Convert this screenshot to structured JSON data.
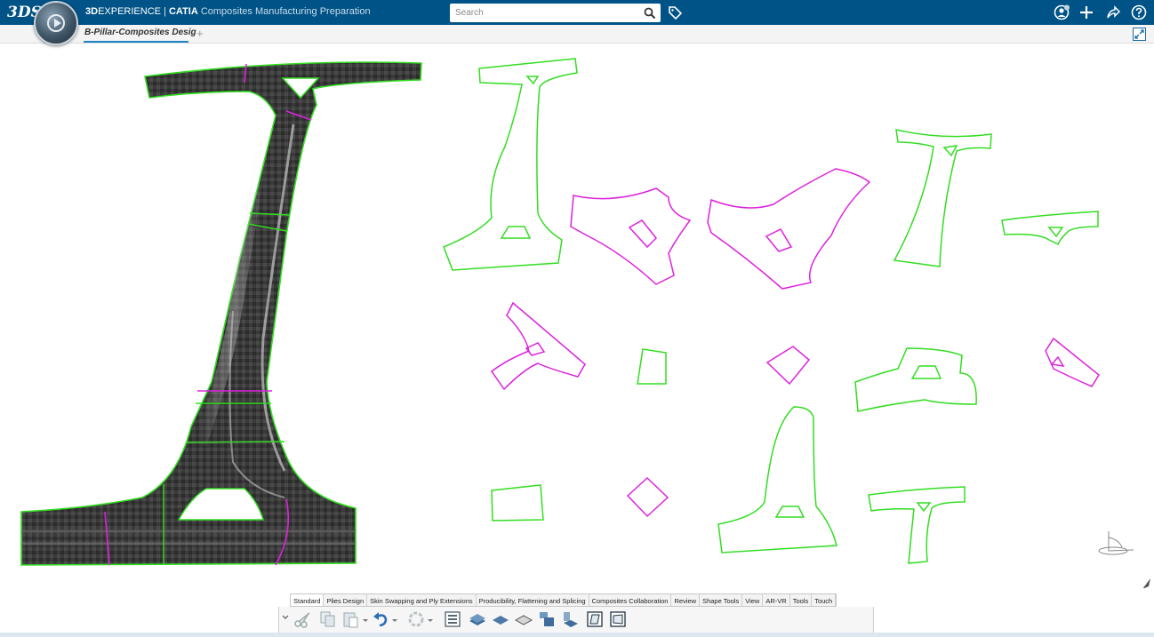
{
  "header": {
    "brand_logo": "3DS",
    "brand_3d": "3D",
    "brand_experience": "EXPERIENCE",
    "separator": " | ",
    "brand_catia": "CATIA",
    "app_name": " Composites Manufacturing Preparation",
    "search": {
      "placeholder": "Search",
      "value": ""
    },
    "icons": [
      "compass-icon",
      "search-icon",
      "tag-icon",
      "user-icon",
      "plus-icon",
      "share-icon",
      "help-icon"
    ],
    "accent_color": "#005386"
  },
  "tabs": {
    "active_label": "B-Pillar-Composites Desig",
    "add_label": "+"
  },
  "viewport": {
    "colors": {
      "ply_outline": "#33dd22",
      "splice_outline": "#dd22dd",
      "laminate": "#3b3b3b"
    }
  },
  "action_bar": {
    "tabs": [
      "Standard",
      "Plies Design",
      "Skin Swapping and Ply Extensions",
      "Producibility, Flattening and Splicing",
      "Composites Collaboration",
      "Review",
      "Shape Tools",
      "View",
      "AR-VR",
      "Tools",
      "Touch"
    ],
    "active_tab": "Standard",
    "tools": [
      "cut-icon",
      "copy-icon",
      "paste-icon",
      "undo-icon",
      "update-icon",
      "ply-table-icon",
      "plies-group-icon",
      "ply-icon",
      "core-icon",
      "stacking-icon",
      "ply-exploder-icon",
      "flatten-icon",
      "surface-icon"
    ]
  }
}
